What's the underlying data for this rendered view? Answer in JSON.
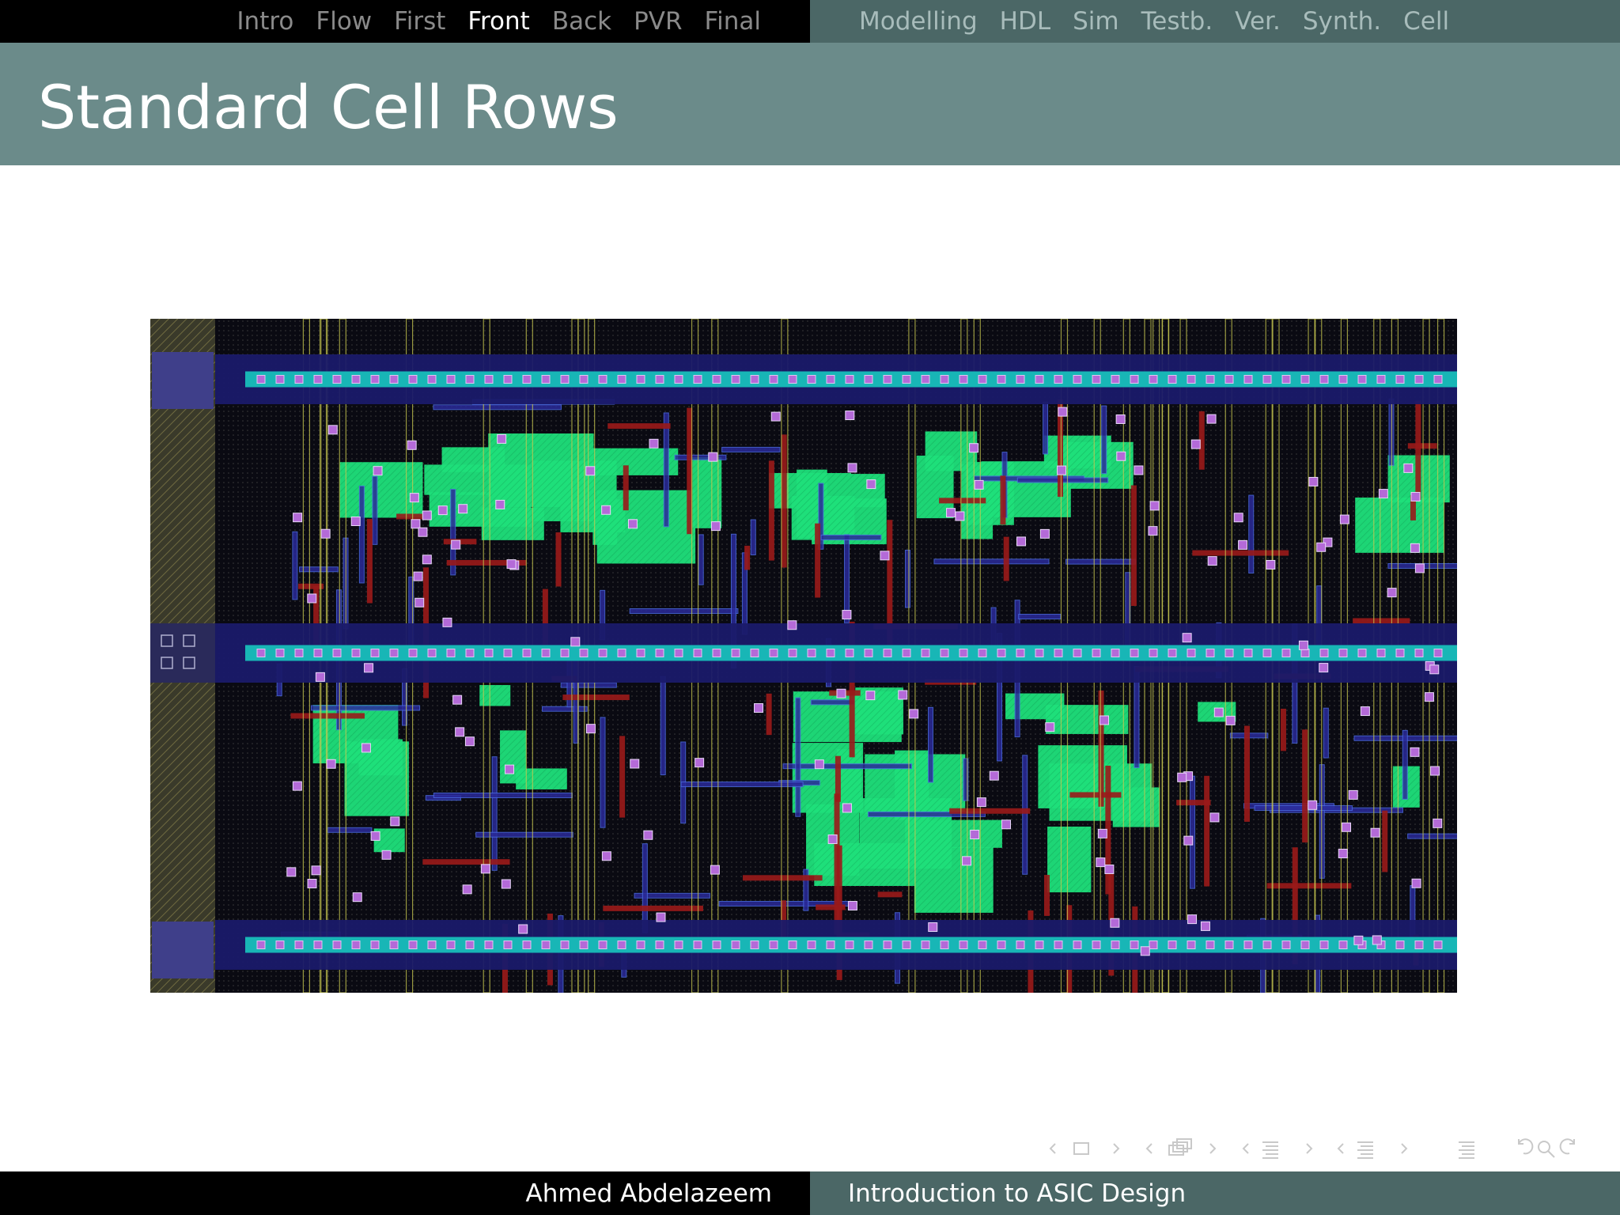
{
  "nav": {
    "sections": [
      {
        "label": "Intro"
      },
      {
        "label": "Flow"
      },
      {
        "label": "First"
      },
      {
        "label": "Front"
      },
      {
        "label": "Back"
      },
      {
        "label": "PVR"
      },
      {
        "label": "Final"
      }
    ],
    "active_section": "Front",
    "subsections": [
      {
        "label": "Modelling"
      },
      {
        "label": "HDL"
      },
      {
        "label": "Sim"
      },
      {
        "label": "Testb."
      },
      {
        "label": "Ver."
      },
      {
        "label": "Synth."
      },
      {
        "label": "Cell"
      }
    ],
    "active_subsection": "Cell"
  },
  "slide": {
    "title": "Standard Cell Rows"
  },
  "footer": {
    "author": "Ahmed Abdelazeem",
    "course": "Introduction to ASIC Design"
  },
  "colors": {
    "nav_bg_left": "#000000",
    "nav_bg_right": "#4b6766",
    "title_bg": "#6b8b8a",
    "active_text": "#ffffff",
    "inactive_text": "#8a8a8a",
    "layout_diffusion": "#1ee07a",
    "layout_poly": "#b01e1e",
    "layout_metal1": "#2a2a9a",
    "layout_rail": "#18b6b6",
    "layout_via": "#b46ad8"
  },
  "icons": [
    "left-arrow-icon",
    "frame-icon",
    "right-arrow-icon",
    "frames-icon",
    "align-icon",
    "search-icon",
    "undo-icon",
    "redo-icon"
  ]
}
